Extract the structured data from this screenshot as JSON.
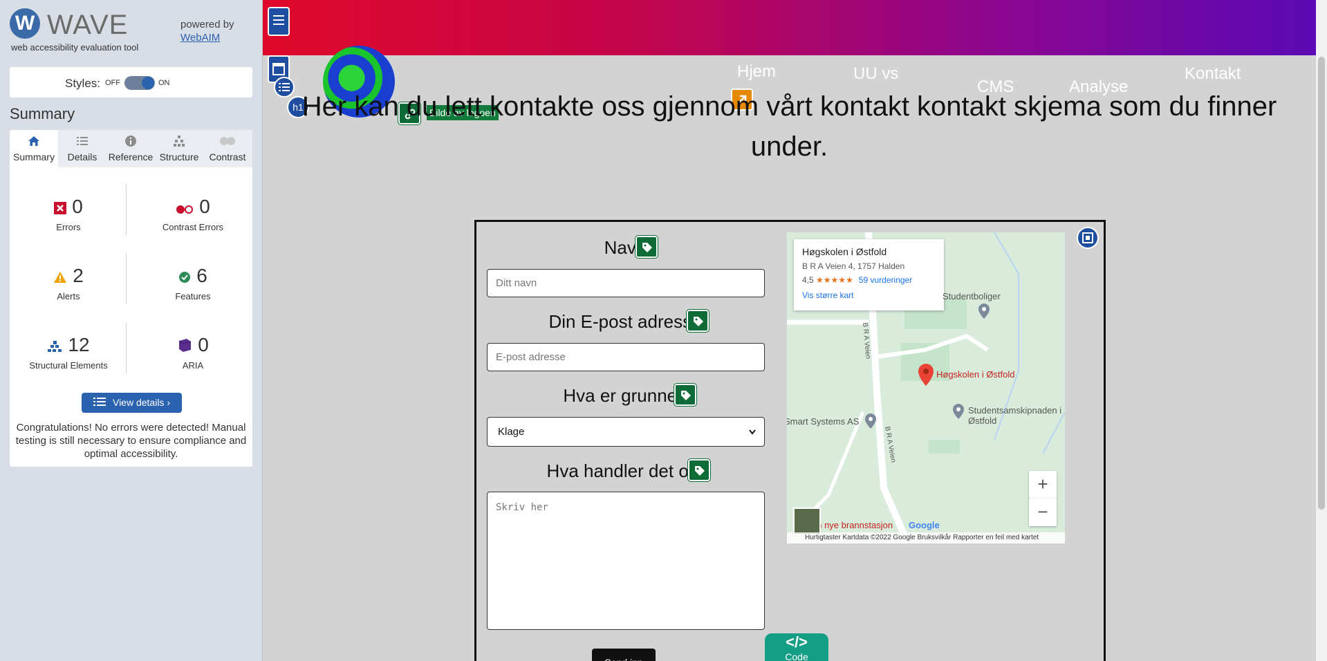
{
  "wave": {
    "logo_letter": "W",
    "name": "WAVE",
    "tagline": "web accessibility evaluation tool",
    "powered_by": "powered by",
    "powered_link": "WebAIM",
    "styles_label": "Styles:",
    "styles_off": "OFF",
    "styles_on": "ON",
    "summary_title": "Summary",
    "tabs": [
      {
        "label": "Summary",
        "icon": "home-icon"
      },
      {
        "label": "Details",
        "icon": "list-icon"
      },
      {
        "label": "Reference",
        "icon": "info-icon"
      },
      {
        "label": "Structure",
        "icon": "hierarchy-icon"
      },
      {
        "label": "Contrast",
        "icon": "contrast-icon"
      }
    ],
    "stats": [
      {
        "count": "0",
        "label": "Errors",
        "icon": "error-icon",
        "color": "#c8102e"
      },
      {
        "count": "0",
        "label": "Contrast Errors",
        "icon": "contrast-error-icon",
        "color": "#c8102e"
      },
      {
        "count": "2",
        "label": "Alerts",
        "icon": "alert-icon",
        "color": "#f0a000"
      },
      {
        "count": "6",
        "label": "Features",
        "icon": "feature-icon",
        "color": "#2e8b57"
      },
      {
        "count": "12",
        "label": "Structural Elements",
        "icon": "structure-icon",
        "color": "#2a62b0"
      },
      {
        "count": "0",
        "label": "ARIA",
        "icon": "aria-icon",
        "color": "#5b2d8e"
      }
    ],
    "view_details": "View details ›",
    "congrats": "Congratulations! No errors were detected! Manual testing is still necessary to ensure compliance and optimal accessibility."
  },
  "page": {
    "nav": [
      "Hjem",
      "UU vs",
      "CMS",
      "Analyse",
      "Kontakt"
    ],
    "heading": "Her kan du lett kontakte oss gjennom vårt kontakt kontakt skjema som du finner under.",
    "logo_alt": "Bilde av logoen",
    "form": {
      "name_label": "Navn",
      "name_placeholder": "Ditt navn",
      "email_label": "Din E-post adresse",
      "email_placeholder": "E-post adresse",
      "reason_label": "Hva er grunnen",
      "reason_value": "Klage",
      "about_label": "Hva handler det om",
      "about_placeholder": "Skriv her",
      "submit": "Send inn"
    },
    "map": {
      "place": "Høgskolen i Østfold",
      "address": "B R A Veien 4, 1757 Halden",
      "rating": "4,5",
      "stars": "★★★★★",
      "reviews": "59 vurderinger",
      "larger_map": "Vis større kart",
      "labels": [
        "Studentboliger",
        "Høgskolen i Østfold",
        "Studentsamskipnaden i Østfold",
        "Smart Systems AS",
        "B R A Veien",
        "B R A Veien",
        "en nye brannstasjon"
      ],
      "footer": "Hurtigtaster   Kartdata ©2022 Google   Bruksvilkår   Rapporter en feil med kartet",
      "zoom_in": "+",
      "zoom_out": "−",
      "google": "Google"
    },
    "code_badge": "Code",
    "h1_badge": "h1",
    "code_symbol": "</>"
  }
}
